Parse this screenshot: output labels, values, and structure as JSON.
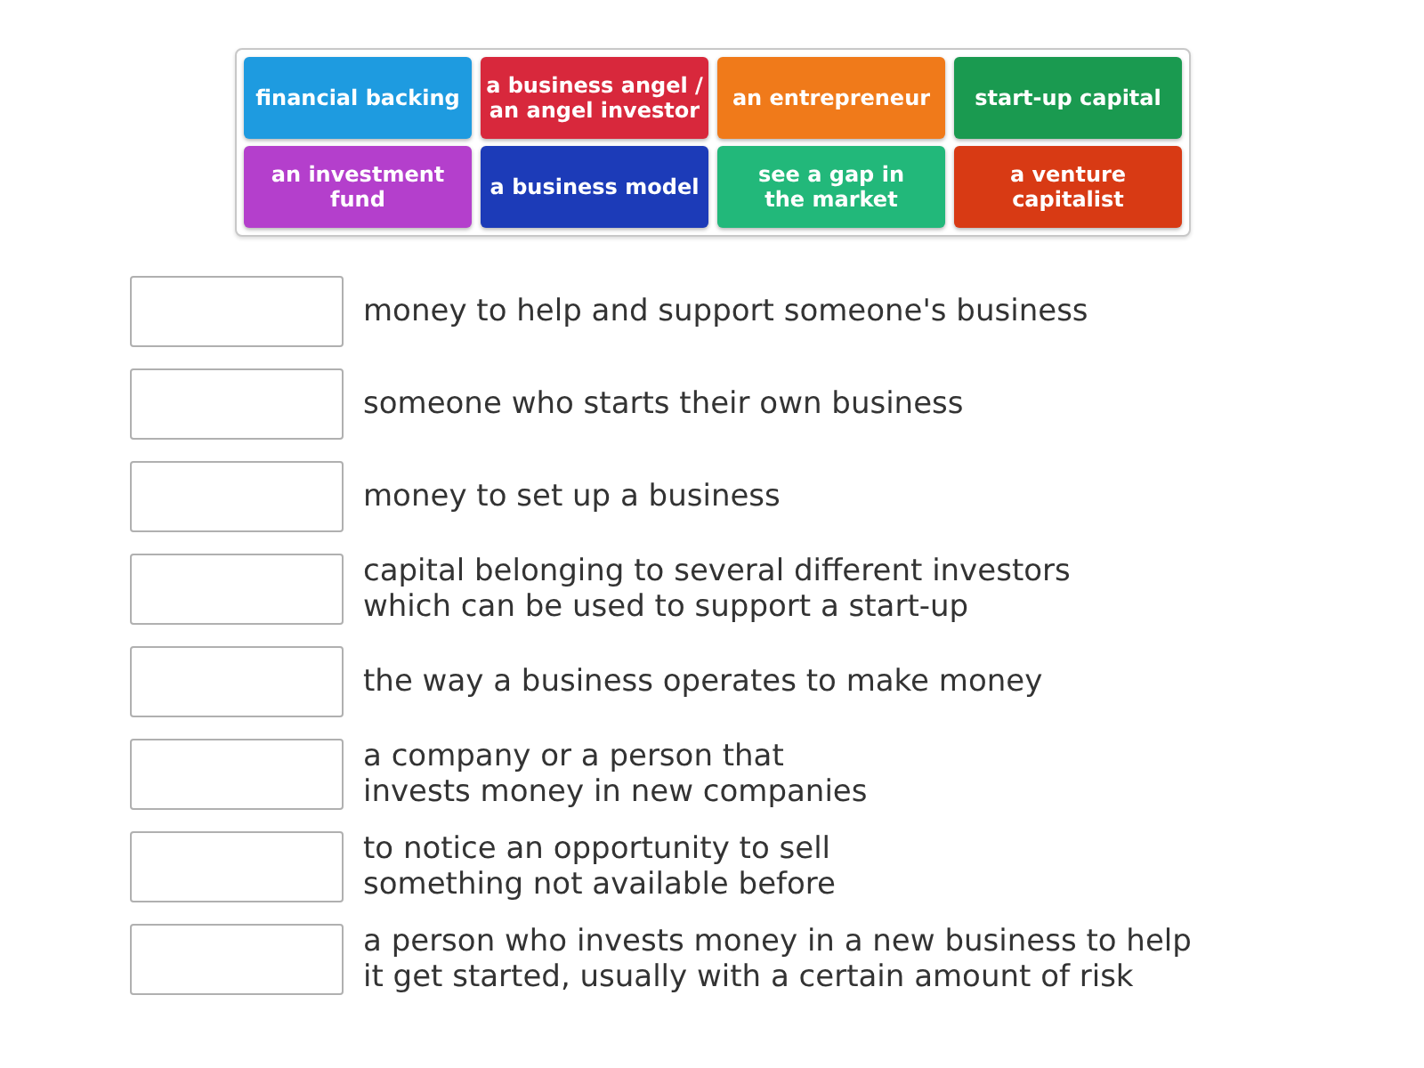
{
  "tiles": [
    {
      "lines": [
        "financial backing"
      ],
      "color": "#1e9be0"
    },
    {
      "lines": [
        "a business angel /",
        "an angel investor"
      ],
      "color": "#d8283c"
    },
    {
      "lines": [
        "an entrepreneur"
      ],
      "color": "#f07a1a"
    },
    {
      "lines": [
        "start-up capital"
      ],
      "color": "#1a9a50"
    },
    {
      "lines": [
        "an investment",
        "fund"
      ],
      "color": "#b43fcc"
    },
    {
      "lines": [
        "a business model"
      ],
      "color": "#1c3bb8"
    },
    {
      "lines": [
        "see a gap in",
        "the market"
      ],
      "color": "#22b87a"
    },
    {
      "lines": [
        "a venture",
        "capitalist"
      ],
      "color": "#d83a14"
    }
  ],
  "definitions": [
    {
      "lines": [
        "money to help and support someone's business"
      ]
    },
    {
      "lines": [
        "someone who starts their own business"
      ]
    },
    {
      "lines": [
        "money to set up a business"
      ]
    },
    {
      "lines": [
        "capital belonging to several different investors",
        "which can be used to support a start-up"
      ]
    },
    {
      "lines": [
        "the way a business operates to make money"
      ]
    },
    {
      "lines": [
        "a company or a person that",
        "invests money in new companies"
      ]
    },
    {
      "lines": [
        "to notice an opportunity to sell",
        "something not available before"
      ]
    },
    {
      "lines": [
        "a person who invests money in a new business to help",
        "it get started, usually with a certain amount of risk"
      ]
    }
  ]
}
